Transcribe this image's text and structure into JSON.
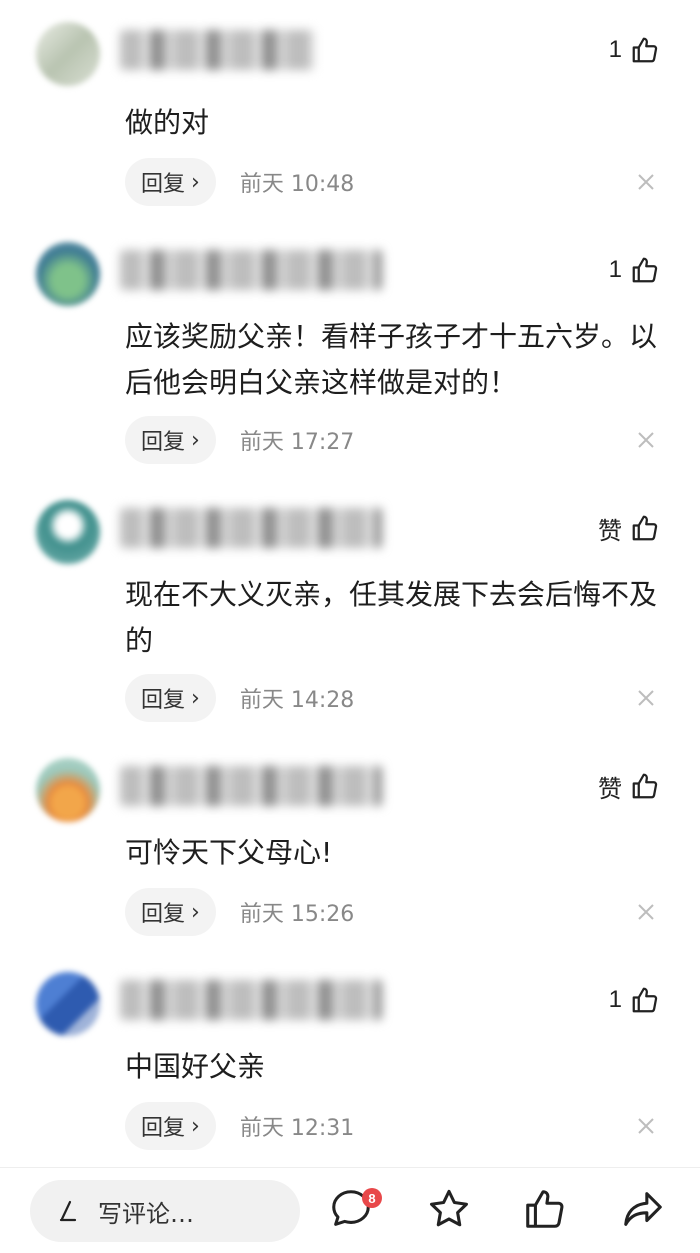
{
  "comments": [
    {
      "likes": "1",
      "text": "做的对",
      "reply_label": "回复",
      "time": "前天  10:48"
    },
    {
      "likes": "1",
      "text": "应该奖励父亲！看样子孩子才十五六岁。以后他会明白父亲这样做是对的！",
      "reply_label": "回复",
      "time": "前天  17:27"
    },
    {
      "likes": "赞",
      "text": "现在不大义灭亲，任其发展下去会后悔不及的",
      "reply_label": "回复",
      "time": "前天  14:28"
    },
    {
      "likes": "赞",
      "text": "可怜天下父母心!",
      "reply_label": "回复",
      "time": "前天  15:26"
    },
    {
      "likes": "1",
      "text": "中国好父亲",
      "reply_label": "回复",
      "time": "前天  12:31"
    }
  ],
  "bottom_bar": {
    "placeholder": "写评论…",
    "comment_badge": "8"
  },
  "colors": {
    "badge": "#e8484a",
    "meta_text": "#888888",
    "reply_bg": "#f3f3f3"
  }
}
